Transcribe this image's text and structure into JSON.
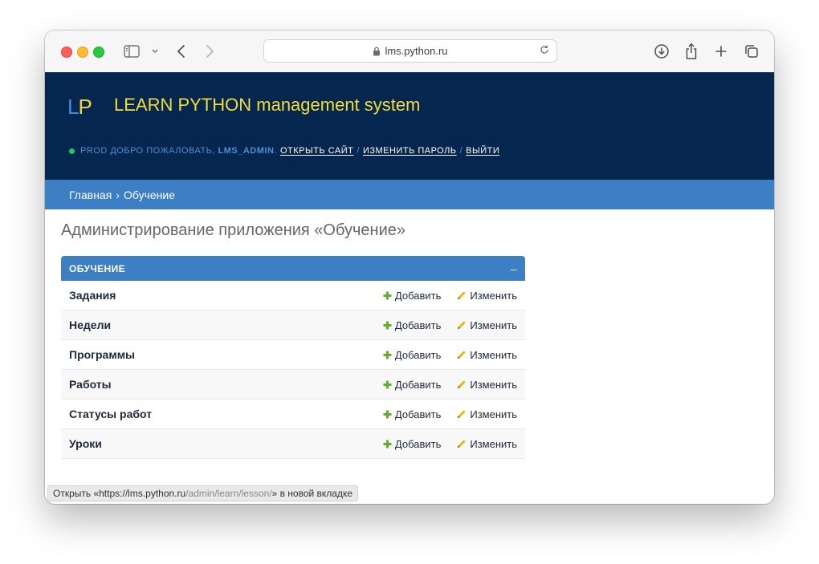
{
  "browser": {
    "url": "lms.python.ru"
  },
  "header": {
    "logo_l": "L",
    "logo_p": "P",
    "site_title": "LEARN PYTHON management system",
    "env_label": "PROD",
    "welcome": "ДОБРО ПОЖАЛОВАТЬ,",
    "username": "LMS_ADMIN",
    "open_site": "ОТКРЫТЬ САЙТ",
    "change_password": "ИЗМЕНИТЬ ПАРОЛЬ",
    "logout": "ВЫЙТИ",
    "separator": "/",
    "env_color": "#22c55e"
  },
  "breadcrumbs": {
    "home": "Главная",
    "separator": "›",
    "current": "Обучение"
  },
  "content": {
    "page_title": "Администрирование приложения «Обучение»",
    "module": {
      "caption": "Обучение",
      "collapse": "–",
      "add_label": "Добавить",
      "change_label": "Изменить",
      "rows": [
        {
          "name": "Задания"
        },
        {
          "name": "Недели"
        },
        {
          "name": "Программы"
        },
        {
          "name": "Работы"
        },
        {
          "name": "Статусы работ"
        },
        {
          "name": "Уроки"
        }
      ]
    }
  },
  "status": {
    "prefix": "Открыть «https://lms.python.ru",
    "path": "/admin/learn/lesson/",
    "suffix": "» в новой вкладке"
  },
  "colors": {
    "header_bg": "#05264f",
    "title": "#f3dc3b",
    "accent": "#3d7fc4",
    "add_icon": "#5fb323",
    "change_icon": "#f0b400"
  }
}
